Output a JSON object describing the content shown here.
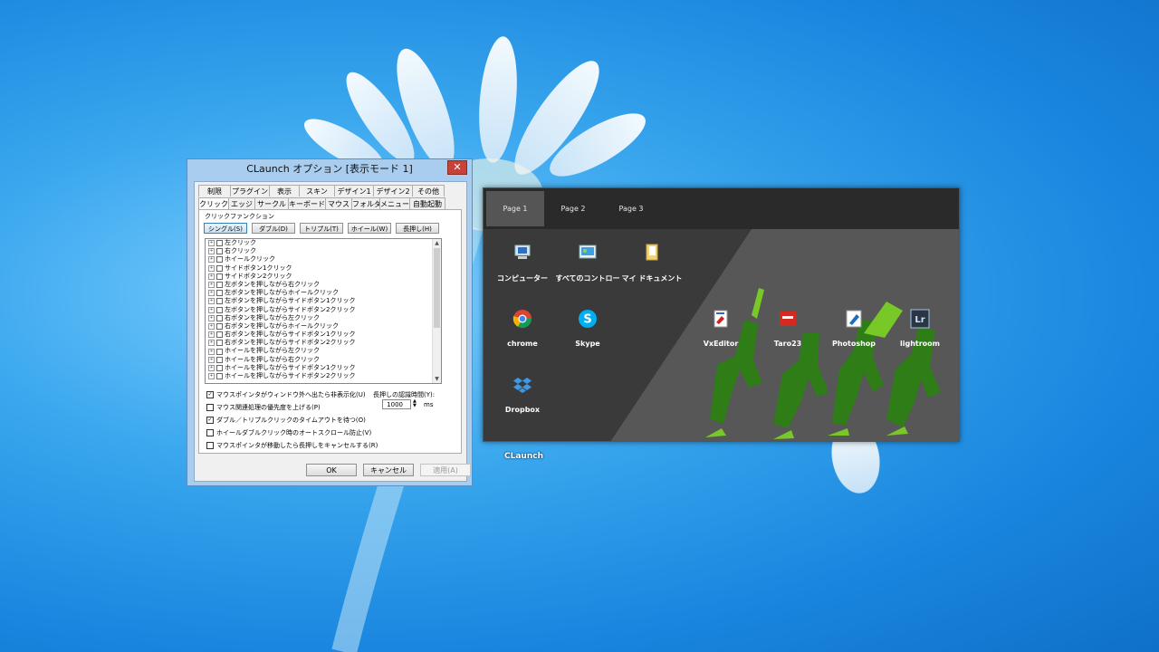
{
  "dialog": {
    "title": "CLaunch オプション [表示モード 1]",
    "close_label": "✕",
    "tabs_row1": [
      "制限",
      "プラグイン",
      "表示",
      "スキン",
      "デザイン1",
      "デザイン2",
      "その他"
    ],
    "tabs_row2": [
      "クリック",
      "エッジ",
      "サークル",
      "キーボード",
      "マウス",
      "フォルダ",
      "メニュー",
      "自動起動"
    ],
    "active_tab": "クリック",
    "group_label": "クリックファンクション",
    "mode_buttons": [
      "シングル(S)",
      "ダブル(D)",
      "トリプル(T)",
      "ホイール(W)",
      "長押し(H)"
    ],
    "tree_items": [
      "左クリック",
      "右クリック",
      "ホイールクリック",
      "サイドボタン1クリック",
      "サイドボタン2クリック",
      "左ボタンを押しながら右クリック",
      "左ボタンを押しながらホイールクリック",
      "左ボタンを押しながらサイドボタン1クリック",
      "左ボタンを押しながらサイドボタン2クリック",
      "右ボタンを押しながら左クリック",
      "右ボタンを押しながらホイールクリック",
      "右ボタンを押しながらサイドボタン1クリック",
      "右ボタンを押しながらサイドボタン2クリック",
      "ホイールを押しながら左クリック",
      "ホイールを押しながら右クリック",
      "ホイールを押しながらサイドボタン1クリック",
      "ホイールを押しながらサイドボタン2クリック"
    ],
    "options": [
      {
        "label": "マウスポインタがウィンドウ外へ出たら非表示化(U)",
        "checked": true
      },
      {
        "label": "マウス関連処理の優先度を上げる(P)",
        "checked": false
      },
      {
        "label": "ダブル／トリプルクリックのタイムアウトを待つ(O)",
        "checked": true
      },
      {
        "label": "ホイールダブルクリック時のオートスクロール防止(V)",
        "checked": false
      },
      {
        "label": "マウスポインタが移動したら長押しをキャンセルする(R)",
        "checked": false
      }
    ],
    "longpress_label": "長押しの認識時間(Y):",
    "longpress_value": "1000",
    "longpress_unit": "ms",
    "ok_label": "OK",
    "cancel_label": "キャンセル",
    "apply_label": "適用(A)"
  },
  "launcher": {
    "tabs": [
      "Page 1",
      "Page 2",
      "Page 3"
    ],
    "active_tab": "Page 1",
    "items": [
      {
        "label": "コンピューター",
        "icon": "computer-icon"
      },
      {
        "label": "すべてのコントロー",
        "icon": "control-panel-icon"
      },
      {
        "label": "マイ ドキュメント",
        "icon": "folder-icon"
      },
      {
        "label": "chrome",
        "icon": "chrome-icon"
      },
      {
        "label": "Skype",
        "icon": "skype-icon"
      },
      {
        "label": "VxEditor",
        "icon": "vxeditor-icon"
      },
      {
        "label": "Taro23",
        "icon": "taro-icon"
      },
      {
        "label": "Photoshop",
        "icon": "photoshop-icon"
      },
      {
        "label": "lightroom",
        "icon": "lightroom-icon"
      },
      {
        "label": "Dropbox",
        "icon": "dropbox-icon"
      }
    ]
  },
  "desktop": {
    "icon_label": "CLaunch"
  }
}
